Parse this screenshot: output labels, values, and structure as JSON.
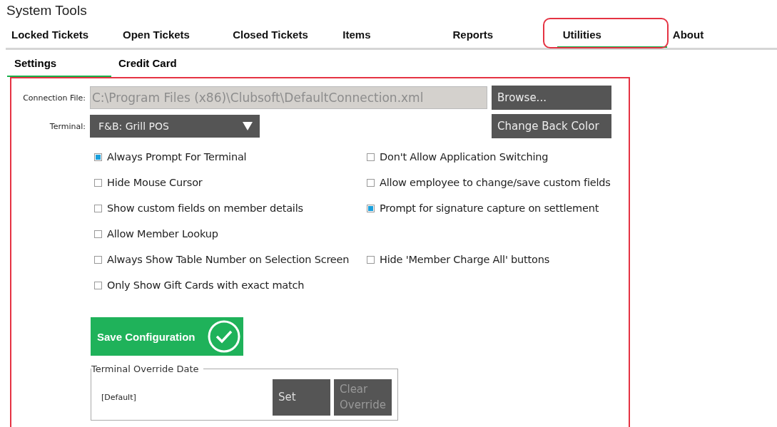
{
  "window": {
    "title": "System Tools"
  },
  "tabs": [
    {
      "label": "Locked Tickets",
      "selected": false,
      "circled": false
    },
    {
      "label": "Open Tickets",
      "selected": false,
      "circled": false
    },
    {
      "label": "Closed Tickets",
      "selected": false,
      "circled": false
    },
    {
      "label": "Items",
      "selected": false,
      "circled": false
    },
    {
      "label": "Reports",
      "selected": false,
      "circled": false
    },
    {
      "label": "Utilities",
      "selected": true,
      "circled": true
    },
    {
      "label": "About",
      "selected": false,
      "circled": false
    }
  ],
  "subtabs": [
    {
      "label": "Settings",
      "selected": true
    },
    {
      "label": "Credit Card",
      "selected": false
    }
  ],
  "connection_file": {
    "label": "Connection File:",
    "value": "C:\\Program Files (x86)\\Clubsoft\\DefaultConnection.xml",
    "button": "Browse..."
  },
  "terminal": {
    "label": "Terminal:",
    "value": "F&B: Grill POS",
    "button": "Change Back Color"
  },
  "option_rows": [
    {
      "left": {
        "label": "Always Prompt For Terminal",
        "checked": true
      },
      "right": {
        "label": "Don't Allow Application Switching",
        "checked": false
      }
    },
    {
      "left": {
        "label": "Hide Mouse Cursor",
        "checked": false
      },
      "right": {
        "label": "Allow employee to change/save custom fields",
        "checked": false
      }
    },
    {
      "left": {
        "label": "Show custom fields on member details",
        "checked": false
      },
      "right": {
        "label": "Prompt for signature capture on settlement",
        "checked": true
      }
    },
    {
      "left": {
        "label": "Allow Member Lookup",
        "checked": false
      }
    },
    {
      "left": {
        "label": "Always Show Table Number on Selection Screen",
        "checked": false
      },
      "right": {
        "label": "Hide 'Member Charge All' buttons",
        "checked": false
      }
    },
    {
      "left": {
        "label": "Only Show Gift Cards with exact match",
        "checked": false
      }
    }
  ],
  "save_button": "Save Configuration",
  "override": {
    "legend": "Terminal Override Date",
    "value": "[Default]",
    "buttons": [
      {
        "label": "Set",
        "disabled": false
      },
      {
        "label": "Clear Override",
        "disabled": true
      }
    ]
  }
}
